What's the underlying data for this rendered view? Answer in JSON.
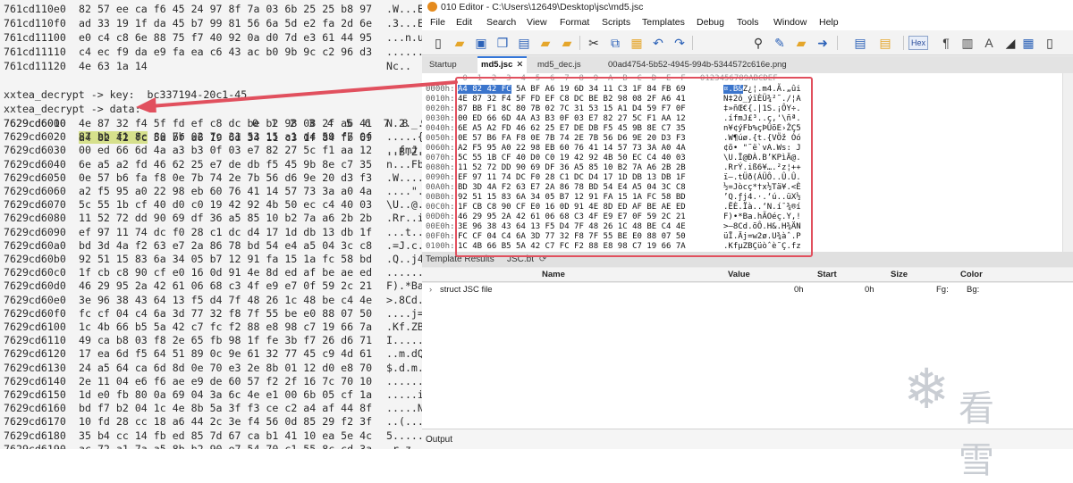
{
  "terminal": {
    "rows_top": [
      {
        "addr": "761cd110e0",
        "hex": "82 57 ee ca f6 45 24 97 8f 7a 03 6b 25 25 b8 97",
        "ascii": ".W...E$..z.k%%.."
      },
      {
        "addr": "761cd110f0",
        "hex": "ad 33 19 1f da 45 b7 99 81 56 6a 5d e2 fa 2d 6e",
        "ascii": ".3...E...Vj]..-n"
      },
      {
        "addr": "761cd11100",
        "hex": "e0 c4 c8 6e 88 75 f7 40 92 0a d0 7d e3 61 44 95",
        "ascii": "...n.u.@...}.aD."
      },
      {
        "addr": "761cd11110",
        "hex": "c4 ec f9 da e9 fa ea c6 43 ac b0 9b 9c c2 96 d3",
        "ascii": "........C......."
      },
      {
        "addr": "761cd11120",
        "hex": "4e 63 1a 14",
        "ascii": "Nc.."
      }
    ],
    "prompt_key": "xxtea_decrypt -> key:  bc337194-20c1-45",
    "prompt_data": "xxtea_decrypt -> data:",
    "data_header": "0  1  2  3  4  5  6  7  8  9",
    "data_header_ascii": "",
    "highlight_bytes": "a4 82 42 fc",
    "first_row_addr": "7629cd6000",
    "first_row_rest": " 5a bf a6 19 6d 34 11 c3 1f 84 fb 69",
    "first_row_ascii": "..B.Z...m4.....i",
    "rows_data": [
      {
        "addr": "7629cd6010",
        "hex": "4e 87 32 f4 5f fd ef c8 dc be b2 98 08 2f a6 41",
        "ascii": "N.2._......../.A"
      },
      {
        "addr": "7629cd6020",
        "hex": "87 bb f1 8c 80 7b 02 7c 31 53 15 a1 d4 59 f7 0f",
        "ascii": ".....{.|1S...Y.."
      },
      {
        "addr": "7629cd6030",
        "hex": "00 ed 66 6d 4a a3 b3 0f 03 e7 82 27 5c f1 aa 12",
        "ascii": "..fmJ......'\\..."
      },
      {
        "addr": "7629cd6040",
        "hex": "6e a5 a2 fd 46 62 25 e7 de db f5 45 9b 8e c7 35",
        "ascii": "n...Fb%....E...5"
      },
      {
        "addr": "7629cd6050",
        "hex": "0e 57 b6 fa f8 0e 7b 74 2e 7b 56 d6 9e 20 d3 f3",
        "ascii": ".W....{t.{V.. .."
      },
      {
        "addr": "7629cd6060",
        "hex": "a2 f5 95 a0 22 98 eb 60 76 41 14 57 73 3a a0 4a",
        "ascii": "....\"..`vA.Ws:.J"
      },
      {
        "addr": "7629cd6070",
        "hex": "5c 55 1b cf 40 d0 c0 19 42 92 4b 50 ec c4 40 03",
        "ascii": "\\U..@...B.KP..@."
      },
      {
        "addr": "7629cd6080",
        "hex": "11 52 72 dd 90 69 df 36 a5 85 10 b2 7a a6 2b 2b",
        "ascii": ".Rr..i.6....z.++"
      },
      {
        "addr": "7629cd6090",
        "hex": "ef 97 11 74 dc f0 28 c1 dc d4 17 1d db 13 db 1f",
        "ascii": "...t..(........."
      },
      {
        "addr": "7629cd60a0",
        "hex": "bd 3d 4a f2 63 e7 2a 86 78 bd 54 e4 a5 04 3c c8",
        "ascii": ".=J.c.*.x.T...<."
      },
      {
        "addr": "7629cd60b0",
        "hex": "92 51 15 83 6a 34 05 b7 12 91 fa 15 1a fc 58 bd",
        "ascii": ".Q..j4........X."
      },
      {
        "addr": "7629cd60c0",
        "hex": "1f cb c8 90 cf e0 16 0d 91 4e 8d ed af be ae ed",
        "ascii": ".........N......"
      },
      {
        "addr": "7629cd60d0",
        "hex": "46 29 95 2a 42 61 06 68 c3 4f e9 e7 0f 59 2c 21",
        "ascii": "F).*Ba.h.O...Y,!"
      },
      {
        "addr": "7629cd60e0",
        "hex": "3e 96 38 43 64 13 f5 d4 7f 48 26 1c 48 be c4 4e",
        "ascii": ">.8Cd....H&.H..N"
      },
      {
        "addr": "7629cd60f0",
        "hex": "fc cf 04 c4 6a 3d 77 32 f8 7f 55 be e0 88 07 50",
        "ascii": "....j=w2..U....P"
      },
      {
        "addr": "7629cd6100",
        "hex": "1c 4b 66 b5 5a 42 c7 fc f2 88 e8 98 c7 19 66 7a",
        "ascii": ".Kf.ZB........fz"
      },
      {
        "addr": "7629cd6110",
        "hex": "49 ca b8 03 f8 2e 65 fb 98 1f fe 3b f7 26 d6 71",
        "ascii": "I.....e....;.&.q"
      },
      {
        "addr": "7629cd6120",
        "hex": "17 ea 6d f5 64 51 89 0c 9e 61 32 77 45 c9 4d 61",
        "ascii": "..m.dQ...a2wE.Ma"
      },
      {
        "addr": "7629cd6130",
        "hex": "24 a5 64 ca 6d 8d 0e 70 e3 2e 8b 01 12 d0 e8 70",
        "ascii": "$.d.m..p.......p"
      },
      {
        "addr": "7629cd6140",
        "hex": "2e 11 04 e6 f6 ae e9 de 60 57 f2 2f 16 7c 70 10",
        "ascii": "........`W./.|p."
      },
      {
        "addr": "7629cd6150",
        "hex": "1d e0 fb 80 0a 69 04 3a 6c 4e e1 00 6b 05 cf 1a",
        "ascii": ".....i.:lN..k..."
      },
      {
        "addr": "7629cd6160",
        "hex": "bd f7 b2 04 1c 4e 8b 5a 3f f3 ce c2 a4 af 44 8f",
        "ascii": ".....N.Z?.....D."
      },
      {
        "addr": "7629cd6170",
        "hex": "10 fd 28 cc 18 a6 44 2c 3e f4 56 0d 85 29 f2 3f",
        "ascii": "..(...D,>.V..).?"
      },
      {
        "addr": "7629cd6180",
        "hex": "35 b4 cc 14 fb ed 85 7d 67 ca b1 41 10 ea 5e 4c",
        "ascii": "5......}g..A..^L"
      },
      {
        "addr": "7629cd6190",
        "hex": "ac 72 a1 7a a5 8b b2 90 e7 54 70 c1 55 8c cd 3a",
        "ascii": ".r.z.....Tp.U..:"
      }
    ]
  },
  "editor": {
    "title": "010 Editor - C:\\Users\\12649\\Desktop\\jsc\\md5.jsc",
    "menu": [
      "File",
      "Edit",
      "Search",
      "View",
      "Format",
      "Scripts",
      "Templates",
      "Debug",
      "Tools",
      "Window",
      "Help"
    ],
    "hex_label": "Hex",
    "tabs": [
      {
        "label": "Startup"
      },
      {
        "label": "md5.jsc",
        "close": "✕"
      },
      {
        "label": "md5_dec.js"
      },
      {
        "label": "00ad4754-5b52-4945-994b-5344572c616e.png"
      }
    ],
    "column_header": " 0  1  2  3  4  5  6  7  8  9  A  B  C  D  E  F   0123456789ABCDEF",
    "hex_rows": [
      {
        "addr": "0000h:",
        "hex": "A4 82 42 FC 5A BF A6 19 6D 34 11 C3 1F 84 FB 69",
        "ascii": "¤.B&Z¿¦.m4.Ã.„ûi"
      },
      {
        "addr": "0010h:",
        "hex": "4E 87 32 F4 5F FD EF C8 DC BE B2 98 08 2F A6 41",
        "ascii": "N‡2ô_ýïÈÜ¾²˜./¦A"
      },
      {
        "addr": "0020h:",
        "hex": "87 BB F1 8C 80 7B 02 7C 31 53 15 A1 D4 59 F7 0F",
        "ascii": "‡»ñŒ€{.|1S.¡ÔY÷."
      },
      {
        "addr": "0030h:",
        "hex": "00 ED 66 6D 4A A3 B3 0F 03 E7 82 27 5C F1 AA 12",
        "ascii": ".ífmJ£³..ç‚'\\ñª."
      },
      {
        "addr": "0040h:",
        "hex": "6E A5 A2 FD 46 62 25 E7 DE DB F5 45 9B 8E C7 35",
        "ascii": "n¥¢ýFb%çÞÛõE›ŽÇ5"
      },
      {
        "addr": "0050h:",
        "hex": "0E 57 B6 FA F8 0E 7B 74 2E 7B 56 D6 9E 20 D3 F3",
        "ascii": ".W¶úø.{t.{VÖž Óó"
      },
      {
        "addr": "0060h:",
        "hex": "A2 F5 95 A0 22 98 EB 60 76 41 14 57 73 3A A0 4A",
        "ascii": "¢õ• \"˜ë`vA.Ws: J"
      },
      {
        "addr": "0070h:",
        "hex": "5C 55 1B CF 40 D0 C0 19 42 92 4B 50 EC C4 40 03",
        "ascii": "\\U.Ï@ÐÀ.B’KPìÄ@."
      },
      {
        "addr": "0080h:",
        "hex": "11 52 72 DD 90 69 DF 36 A5 85 10 B2 7A A6 2B 2B",
        "ascii": ".RrÝ.iß6¥….²z¦++"
      },
      {
        "addr": "0090h:",
        "hex": "EF 97 11 74 DC F0 28 C1 DC D4 17 1D DB 13 DB 1F",
        "ascii": "ï—.tÜð(ÁÜÔ..Û.Û."
      },
      {
        "addr": "00A0h:",
        "hex": "BD 3D 4A F2 63 E7 2A 86 78 BD 54 E4 A5 04 3C C8",
        "ascii": "½=Jòcç*†x½Tä¥.<È"
      },
      {
        "addr": "00B0h:",
        "hex": "92 51 15 83 6A 34 05 B7 12 91 FA 15 1A FC 58 BD",
        "ascii": "’Q.ƒj4.·.‘ú..üX½"
      },
      {
        "addr": "00C0h:",
        "hex": "1F CB C8 90 CF E0 16 0D 91 4E 8D ED AF BE AE ED",
        "ascii": ".ËÈ.Ïà..‘N.í¯¾®í"
      },
      {
        "addr": "00D0h:",
        "hex": "46 29 95 2A 42 61 06 68 C3 4F E9 E7 0F 59 2C 21",
        "ascii": "F)•*Ba.hÃOéç.Y,!"
      },
      {
        "addr": "00E0h:",
        "hex": "3E 96 38 43 64 13 F5 D4 7F 48 26 1C 48 BE C4 4E",
        "ascii": ">–8Cd.õÔ.H&.H¾ÄN"
      },
      {
        "addr": "00F0h:",
        "hex": "FC CF 04 C4 6A 3D 77 32 F8 7F 55 BE E0 88 07 50",
        "ascii": "üÏ.Äj=w2ø.U¾àˆ.P"
      },
      {
        "addr": "0100h:",
        "hex": "1C 4B 66 B5 5A 42 C7 FC F2 88 E8 98 C7 19 66 7A",
        "ascii": ".KfµZBÇüòˆè˜Ç.fz"
      }
    ],
    "template_results_label": "Template Results",
    "template_file": "JSC.bt",
    "template_columns": {
      "name": "Name",
      "value": "Value",
      "start": "Start",
      "size": "Size",
      "color": "Color"
    },
    "template_row": {
      "expander": "›",
      "name": "struct JSC file",
      "value": "",
      "start": "0h",
      "size": "0h",
      "fg": "Fg:",
      "bg": "Bg:"
    },
    "output_label": "Output"
  },
  "watermark": {
    "text": "看雪"
  },
  "colors": {
    "selection": "#3b75cc",
    "annotation_red": "#e1505e",
    "terminal_bg": "#f4f4f4",
    "byte_highlight": "#d6e08c"
  }
}
